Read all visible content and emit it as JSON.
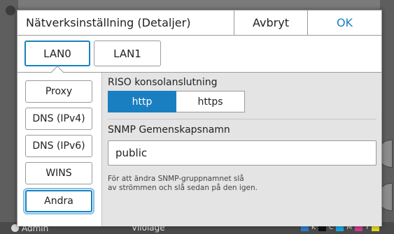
{
  "background": {
    "status_user": "Admin",
    "status_mode": "Viloläge",
    "ink_labels": [
      "K",
      "C",
      "M",
      "Y"
    ]
  },
  "dialog": {
    "title": "Nätverksinställning (Detaljer)",
    "cancel_label": "Avbryt",
    "ok_label": "OK"
  },
  "lan_tabs": [
    {
      "label": "LAN0",
      "active": true
    },
    {
      "label": "LAN1",
      "active": false
    }
  ],
  "sidebar": {
    "items": [
      {
        "label": "Proxy"
      },
      {
        "label": "DNS (IPv4)"
      },
      {
        "label": "DNS (IPv6)"
      },
      {
        "label": "WINS"
      },
      {
        "label": "Andra",
        "selected": true
      }
    ]
  },
  "content": {
    "riso_label": "RISO konsolanslutning",
    "riso_options": [
      "http",
      "https"
    ],
    "riso_selected": "http",
    "snmp_label": "SNMP Gemenskapsnamn",
    "snmp_value": "public",
    "note_line1": "För att ändra SNMP-gruppnamnet slå",
    "note_line2": "av strömmen och slå sedan på den igen."
  },
  "colors": {
    "accent": "#1a7fc1",
    "panel_bg": "#e4e4e4"
  }
}
